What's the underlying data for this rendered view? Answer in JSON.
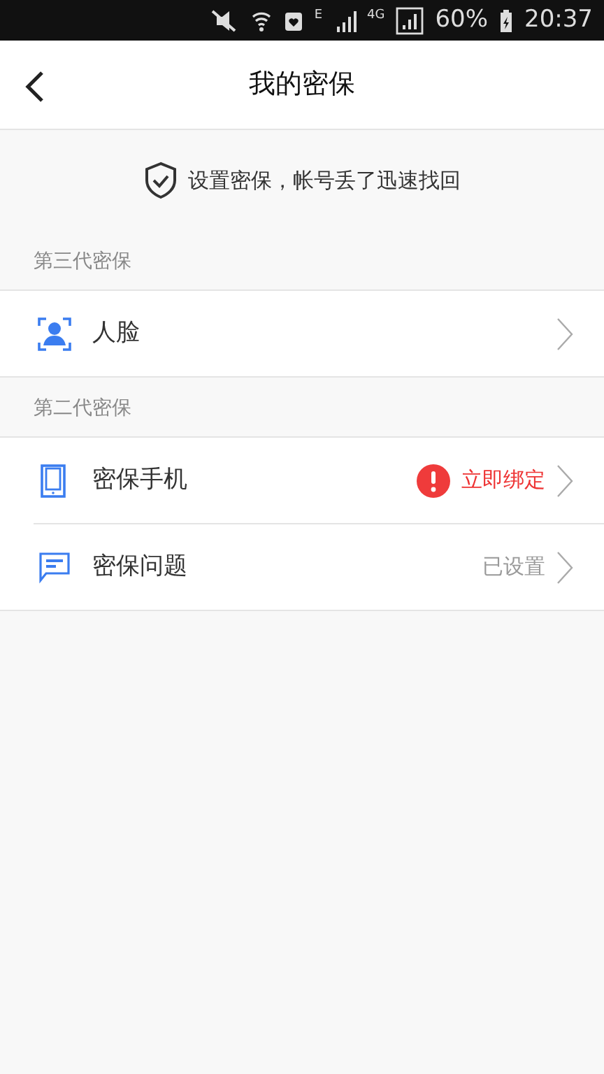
{
  "status_bar": {
    "network": "E",
    "network_2": "4G",
    "battery": "60%",
    "time": "20:37"
  },
  "header": {
    "title": "我的密保"
  },
  "banner": {
    "text": "设置密保，帐号丢了迅速找回"
  },
  "sections": [
    {
      "title": "第三代密保",
      "items": [
        {
          "kind": "face",
          "label": "人脸"
        }
      ]
    },
    {
      "title": "第二代密保",
      "items": [
        {
          "kind": "phone",
          "label": "密保手机",
          "status": "立即绑定",
          "warning": true
        },
        {
          "kind": "chat",
          "label": "密保问题",
          "status": "已设置",
          "warning": false
        }
      ]
    }
  ]
}
